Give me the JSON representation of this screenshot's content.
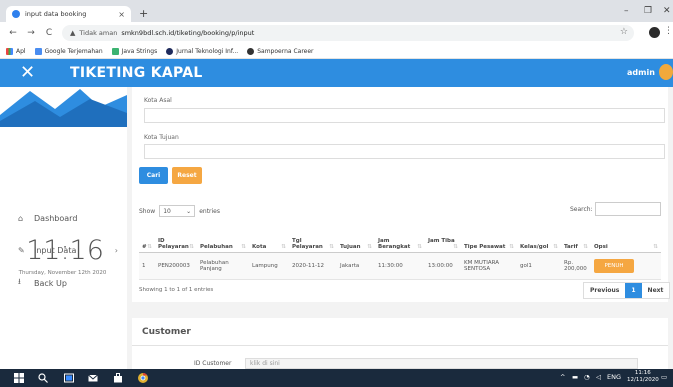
{
  "browser": {
    "tab_title": "input data booking",
    "tab_close": "×",
    "new_tab": "+",
    "win_min": "–",
    "win_max": "❐",
    "win_close": "✕",
    "back": "←",
    "forward": "→",
    "reload": "C",
    "insecure_label": "Tidak aman",
    "url": "smkn9bdl.sch.id/tiketing/booking/p/input",
    "bookmarks": [
      "Apl",
      "Google Terjemahan",
      "Java Strings",
      "Jurnal Teknologi Inf...",
      "Sampoerna Career"
    ]
  },
  "header": {
    "brand": "TIKETING KAPAL",
    "user": "admin",
    "close_glyph": "✕"
  },
  "sidebar": {
    "clock": "11:16",
    "date": "Thursday, November 12th 2020",
    "items": [
      {
        "label": "Dashboard",
        "icon": "home-icon"
      },
      {
        "label": "Input Data",
        "icon": "edit-icon",
        "chevron": "›"
      },
      {
        "label": "Back Up",
        "icon": "download-icon"
      }
    ]
  },
  "form": {
    "kota_asal_label": "Kota Asal",
    "kota_tujuan_label": "Kota Tujuan",
    "cari_label": "Cari",
    "reset_label": "Reset"
  },
  "table": {
    "show_label": "Show",
    "entries_label": "entries",
    "page_size": "10",
    "search_label": "Search:",
    "columns": [
      "#",
      "ID Pelayaran",
      "Pelabuhan",
      "Kota",
      "Tgl Pelayaran",
      "Tujuan",
      "Jam Berangkat",
      "Jam Tiba",
      "Tipe Pesawat",
      "Kelas/gol",
      "Tarif",
      "Opsi"
    ],
    "rows": [
      {
        "no": "1",
        "id": "PEN200003",
        "pelabuhan": "Pelabuhan Panjang",
        "kota": "Lampung",
        "tgl": "2020-11-12",
        "tujuan": "Jakarta",
        "berangkat": "11:30:00",
        "tiba": "13:00:00",
        "tipe": "KM MUTIARA SENTOSA",
        "kelas": "gol1",
        "tarif": "Rp. 200,000",
        "opsi": "PENUH"
      }
    ],
    "info": "Showing 1 to 1 of 1 entries",
    "prev": "Previous",
    "page": "1",
    "next": "Next"
  },
  "customer": {
    "title": "Customer",
    "id_label": "ID Customer",
    "id_placeholder": "klik di sini"
  },
  "taskbar": {
    "lang": "ENG",
    "time": "11:16",
    "date": "12/11/2020",
    "tray_up": "^"
  }
}
